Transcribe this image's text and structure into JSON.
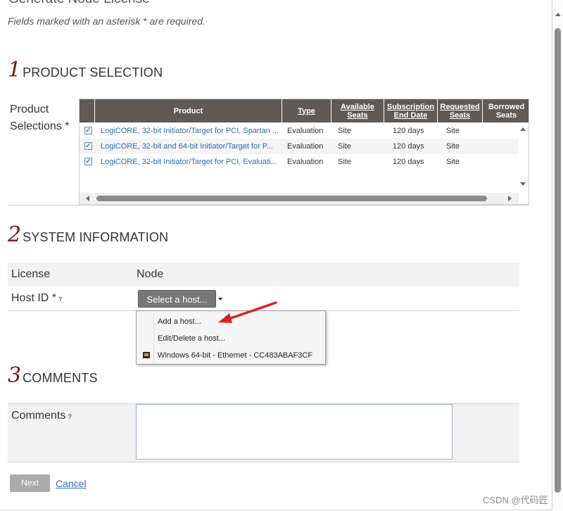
{
  "header": {
    "title": "Generate Node License",
    "required_note": "Fields marked with an asterisk * are required."
  },
  "section1": {
    "number": "1",
    "title": "PRODUCT SELECTION",
    "field_label": "Product Selections *",
    "columns": [
      "Product",
      "Type",
      "Available Seats",
      "Subscription End Date",
      "Requested Seats",
      "Borrowed Seats"
    ],
    "rows": [
      {
        "product": "LogiCORE, 32-bit Initiator/Target for PCI, Spartan ...",
        "type": "Evaluation",
        "available": "Site",
        "end_date": "120 days",
        "requested": "Site",
        "checked": "✓"
      },
      {
        "product": "LogiCORE, 32-bit and 64-bit Initiator/Target for P...",
        "type": "Evaluation",
        "available": "Site",
        "end_date": "120 days",
        "requested": "Site",
        "checked": "✓"
      },
      {
        "product": "LogiCORE, 32-bit Initiator/Target for PCI, Evaluati...",
        "type": "Evaluation",
        "available": "Site",
        "end_date": "120 days",
        "requested": "Site",
        "checked": "✓"
      }
    ]
  },
  "section2": {
    "number": "2",
    "title": "SYSTEM INFORMATION",
    "license_label": "License",
    "license_value": "Node",
    "hostid_label": "Host ID *",
    "help": "?",
    "select_button": "Select a host...",
    "menu_items": [
      "Add a host...",
      "Edit/Delete a host...",
      "Windows 64-bit - Ethernet - CC483ABAF3CF"
    ]
  },
  "section3": {
    "number": "3",
    "title": "COMMENTS",
    "comments_label": "Comments",
    "help": "?",
    "comments_value": ""
  },
  "footer": {
    "next_label": "Next",
    "cancel_label": "Cancel",
    "watermark": "CSDN @代码匠"
  },
  "colors": {
    "section_number": "#7a1521",
    "grid_header": "#5f5a56",
    "link": "#2f6cb5",
    "arrow": "#e02020"
  }
}
